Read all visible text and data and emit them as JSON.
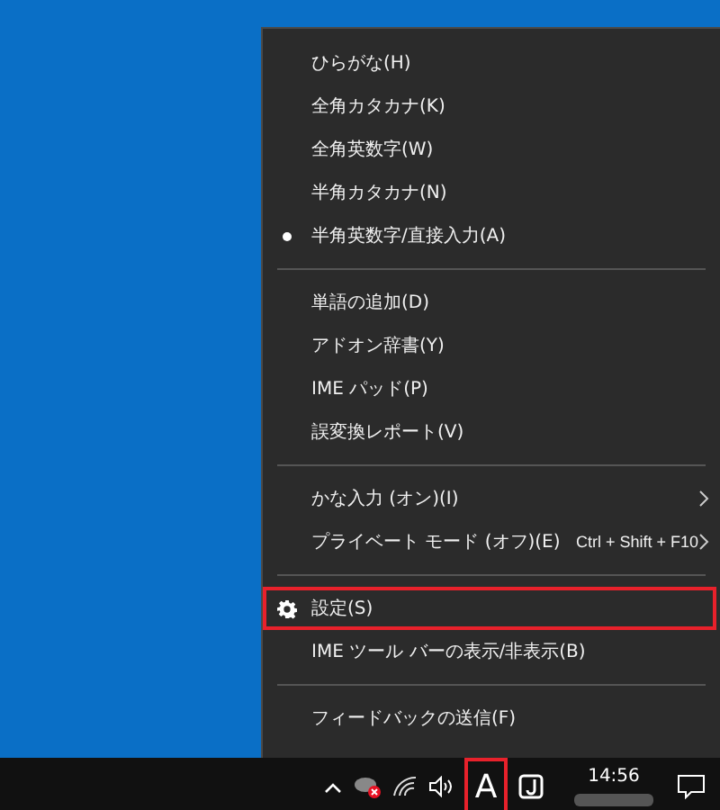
{
  "menu": {
    "groups": [
      {
        "items": [
          {
            "kind": "radio",
            "label": "ひらがな(H)",
            "selected": false
          },
          {
            "kind": "radio",
            "label": "全角カタカナ(K)",
            "selected": false
          },
          {
            "kind": "radio",
            "label": "全角英数字(W)",
            "selected": false
          },
          {
            "kind": "radio",
            "label": "半角カタカナ(N)",
            "selected": false
          },
          {
            "kind": "radio",
            "label": "半角英数字/直接入力(A)",
            "selected": true
          }
        ]
      },
      {
        "items": [
          {
            "kind": "command",
            "label": "単語の追加(D)"
          },
          {
            "kind": "command",
            "label": "アドオン辞書(Y)"
          },
          {
            "kind": "command",
            "label": "IME パッド(P)"
          },
          {
            "kind": "command",
            "label": "誤変換レポート(V)"
          }
        ]
      },
      {
        "items": [
          {
            "kind": "submenu",
            "label": "かな入力 (オン)(I)"
          },
          {
            "kind": "submenu",
            "label": "プライベート モード (オフ)(E)",
            "shortcut": "Ctrl + Shift + F10"
          }
        ]
      },
      {
        "items": [
          {
            "kind": "settings",
            "label": "設定(S)",
            "highlighted": true
          },
          {
            "kind": "command",
            "label": "IME ツール バーの表示/非表示(B)"
          }
        ]
      },
      {
        "items": [
          {
            "kind": "command",
            "label": "フィードバックの送信(F)"
          }
        ]
      }
    ]
  },
  "taskbar": {
    "ime_mode": {
      "label": "A",
      "highlighted": true
    },
    "time": "14:56"
  }
}
